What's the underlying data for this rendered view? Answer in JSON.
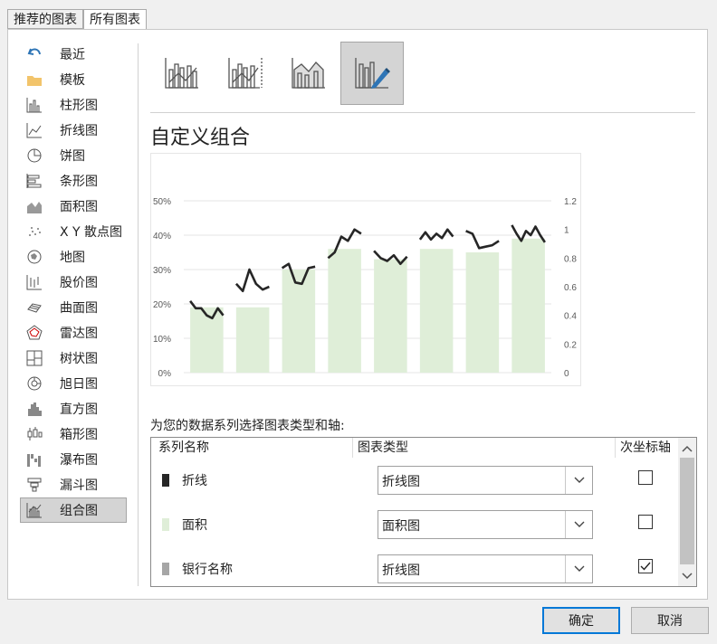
{
  "tabs": [
    "推荐的图表",
    "所有图表"
  ],
  "sidebar": {
    "items": [
      {
        "label": "最近",
        "icon": "recent-icon"
      },
      {
        "label": "模板",
        "icon": "folder-icon"
      },
      {
        "label": "柱形图",
        "icon": "column-chart-icon"
      },
      {
        "label": "折线图",
        "icon": "line-chart-icon"
      },
      {
        "label": "饼图",
        "icon": "pie-chart-icon"
      },
      {
        "label": "条形图",
        "icon": "bar-chart-icon"
      },
      {
        "label": "面积图",
        "icon": "area-chart-icon"
      },
      {
        "label": "X Y 散点图",
        "icon": "scatter-chart-icon"
      },
      {
        "label": "地图",
        "icon": "map-chart-icon"
      },
      {
        "label": "股价图",
        "icon": "stock-chart-icon"
      },
      {
        "label": "曲面图",
        "icon": "surface-chart-icon"
      },
      {
        "label": "雷达图",
        "icon": "radar-chart-icon"
      },
      {
        "label": "树状图",
        "icon": "treemap-chart-icon"
      },
      {
        "label": "旭日图",
        "icon": "sunburst-chart-icon"
      },
      {
        "label": "直方图",
        "icon": "histogram-chart-icon"
      },
      {
        "label": "箱形图",
        "icon": "box-chart-icon"
      },
      {
        "label": "瀑布图",
        "icon": "waterfall-chart-icon"
      },
      {
        "label": "漏斗图",
        "icon": "funnel-chart-icon"
      },
      {
        "label": "组合图",
        "icon": "combo-chart-icon"
      }
    ],
    "selected_index": 18
  },
  "combo_types": [
    "clustered-column-line-icon",
    "clustered-column-line-secondary-icon",
    "stacked-area-column-icon",
    "custom-combo-icon"
  ],
  "title": "自定义组合",
  "chart_data": {
    "type": "bar",
    "categories": [
      "",
      "",
      "",
      "",
      "",
      "",
      "",
      ""
    ],
    "values": [
      0.19,
      0.19,
      0.3,
      0.36,
      0.33,
      0.36,
      0.35,
      0.39
    ],
    "ylim": [
      0,
      0.5
    ],
    "y_tick_labels": [
      "0%",
      "10%",
      "20%",
      "30%",
      "40%",
      "50%"
    ],
    "y2lim": [
      0,
      1.2
    ],
    "y2_tick_labels": [
      "0",
      "0.2",
      "0.4",
      "0.6",
      "0.8",
      "1",
      "1.2"
    ],
    "line_segments": [
      [
        0.5,
        0.45,
        0.45,
        0.4,
        0.38,
        0.45,
        0.4
      ],
      [
        0.62,
        0.57,
        0.72,
        0.62,
        0.58,
        0.6
      ],
      [
        0.73,
        0.76,
        0.63,
        0.62,
        0.73,
        0.74
      ],
      [
        0.8,
        0.84,
        0.95,
        0.92,
        1.0,
        0.97
      ],
      [
        0.85,
        0.8,
        0.78,
        0.82,
        0.76,
        0.81
      ],
      [
        0.93,
        0.98,
        0.93,
        0.97,
        0.94,
        1.0,
        0.95
      ],
      [
        0.99,
        0.97,
        0.87,
        0.88,
        0.89,
        0.92
      ],
      [
        1.03,
        0.97,
        0.92,
        0.99,
        0.96,
        1.02,
        0.96,
        0.91
      ]
    ],
    "bar_color": "#dfeed8",
    "line_color": "#262626",
    "grid": true
  },
  "prompt": "为您的数据系列选择图表类型和轴:",
  "grid": {
    "headers": [
      "系列名称",
      "图表类型",
      "次坐标轴"
    ],
    "rows": [
      {
        "name": "折线",
        "swatch": "#262626",
        "chart_type": "折线图",
        "secondary": false
      },
      {
        "name": "面积",
        "swatch": "#dfeed8",
        "chart_type": "面积图",
        "secondary": false
      },
      {
        "name": "银行名称",
        "swatch": "#a6a6a6",
        "chart_type": "折线图",
        "secondary": true
      }
    ]
  },
  "buttons": {
    "ok": "确定",
    "cancel": "取消"
  }
}
